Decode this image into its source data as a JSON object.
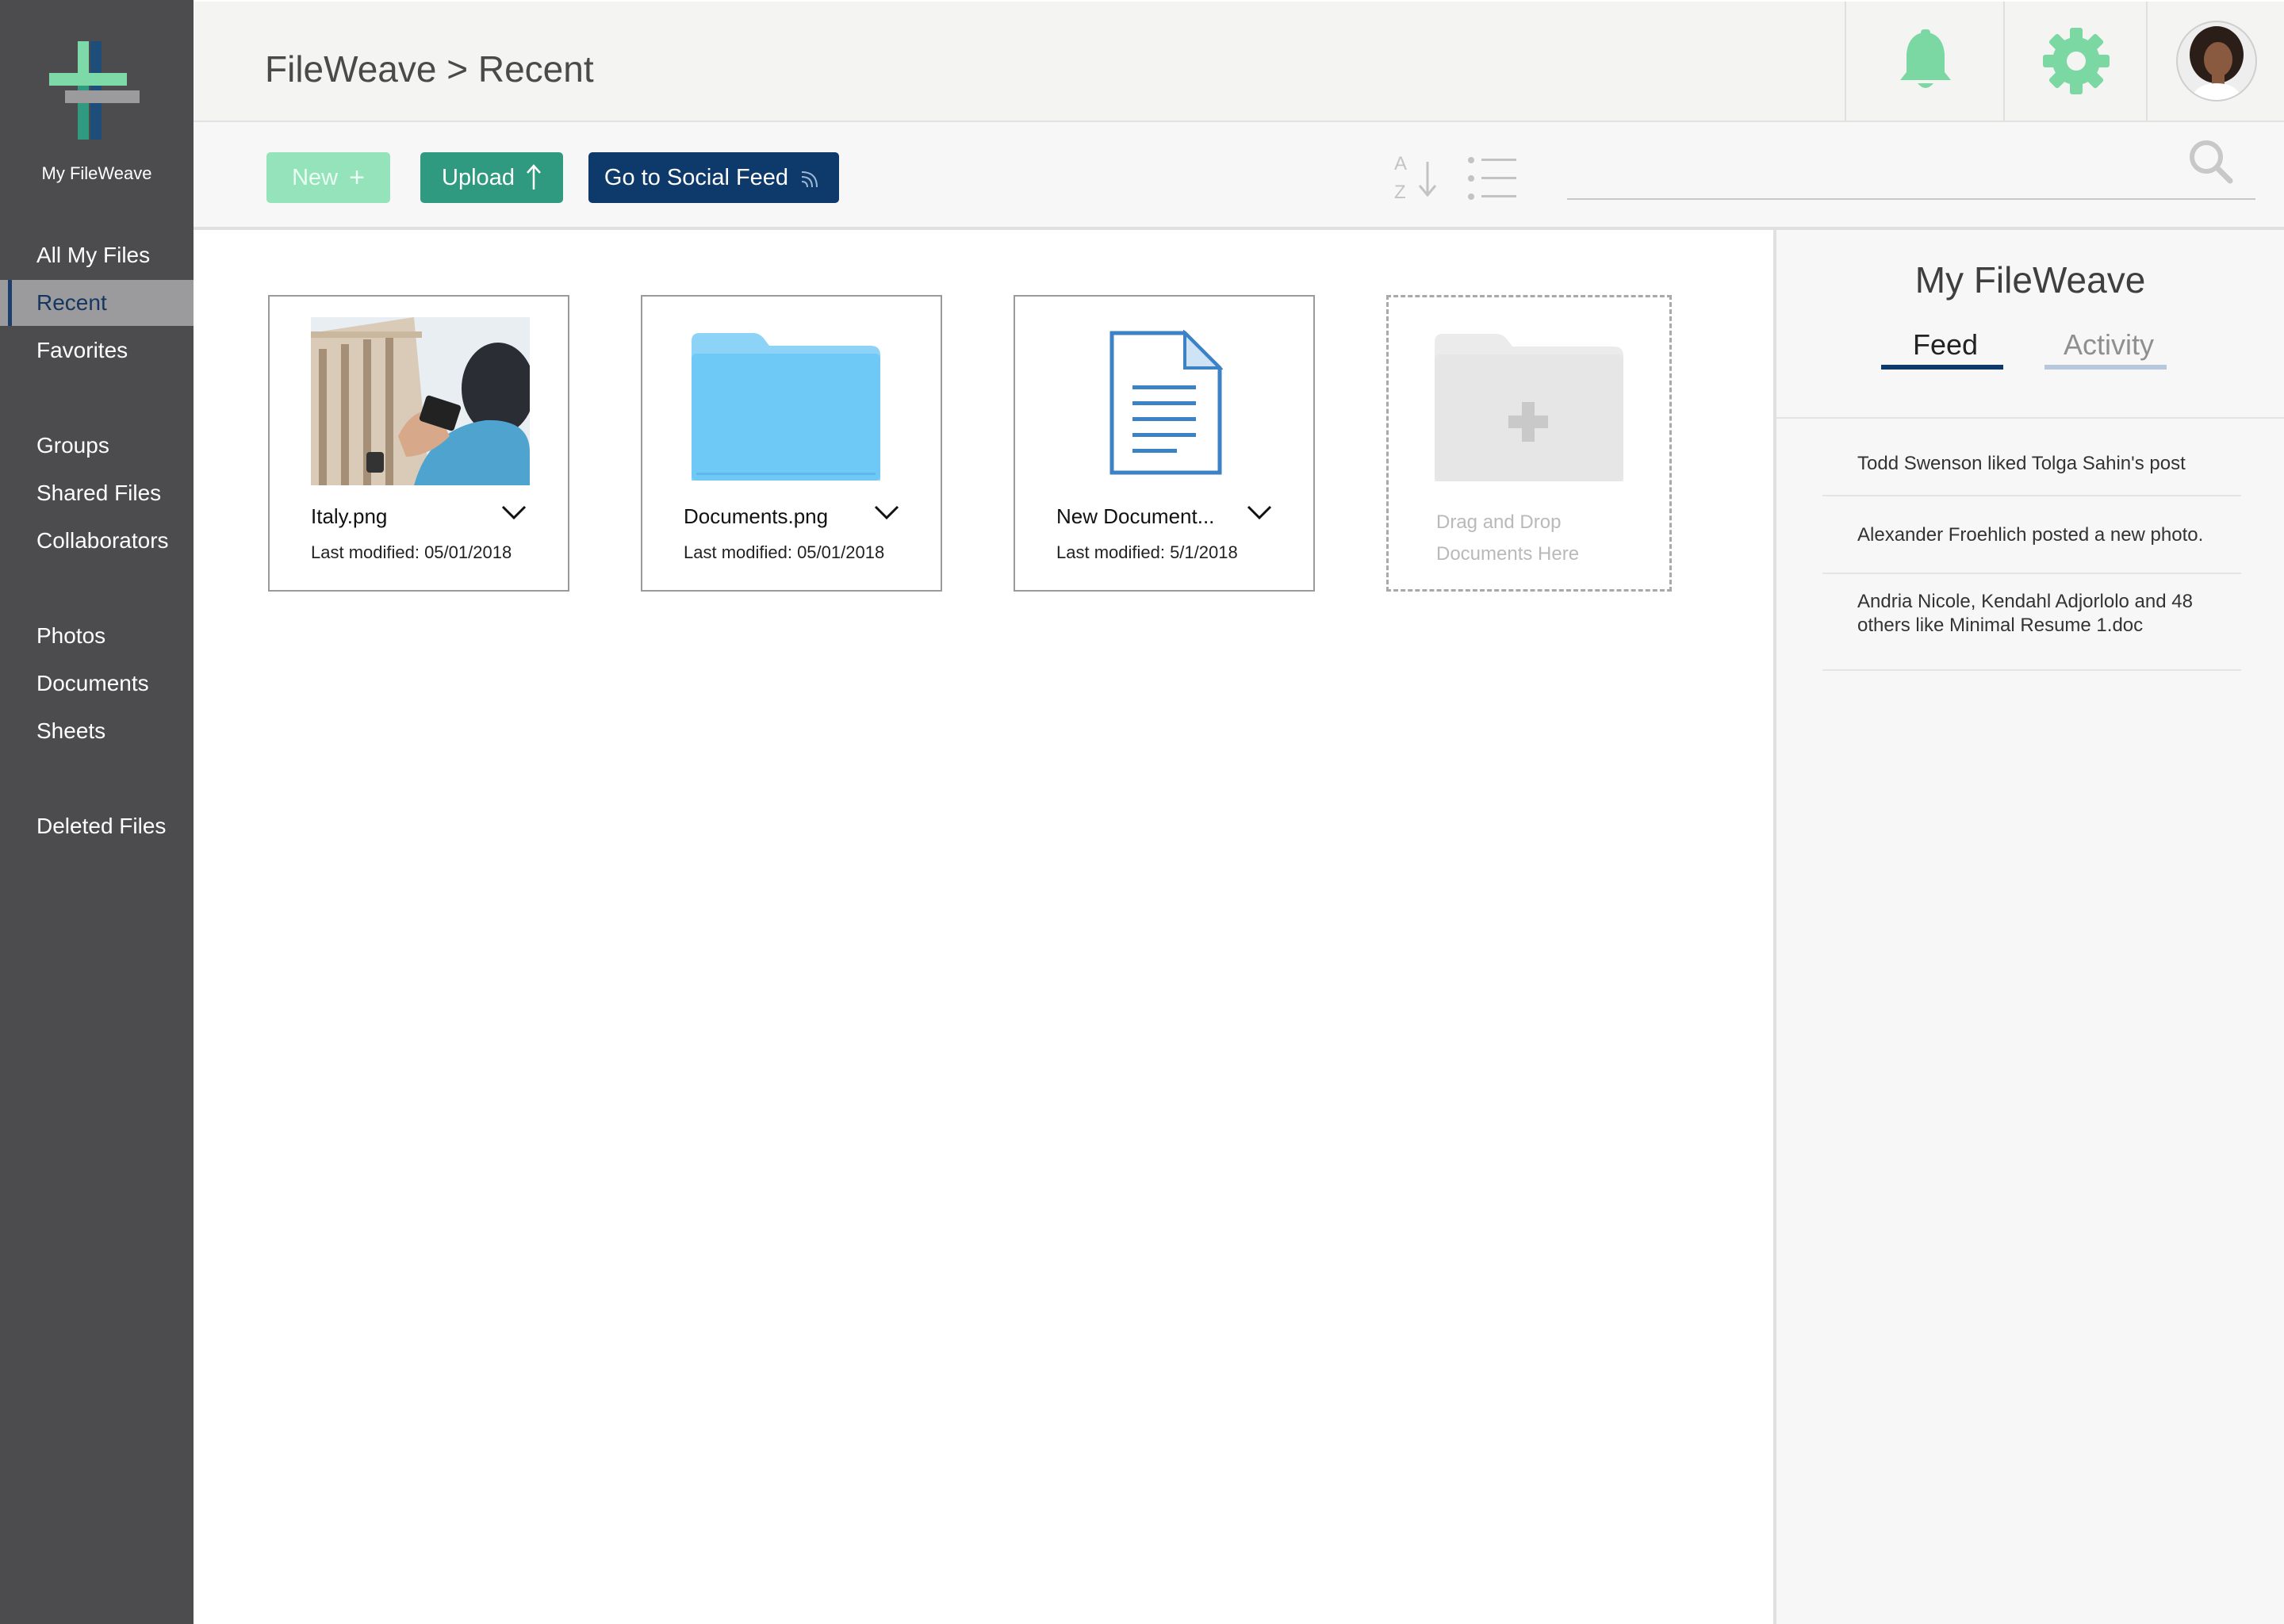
{
  "sidebar": {
    "logo_caption": "My FileWeave",
    "items": [
      {
        "label": "All My Files"
      },
      {
        "label": "Recent"
      },
      {
        "label": "Favorites"
      },
      {
        "label": "Groups"
      },
      {
        "label": "Shared Files"
      },
      {
        "label": "Collaborators"
      },
      {
        "label": "Photos"
      },
      {
        "label": "Documents"
      },
      {
        "label": "Sheets"
      },
      {
        "label": "Deleted Files"
      }
    ],
    "active_item": "Recent"
  },
  "header": {
    "breadcrumb": "FileWeave > Recent",
    "icons": [
      "bell-icon",
      "gear-icon",
      "user-avatar"
    ]
  },
  "toolbar": {
    "new_label": "New",
    "upload_label": "Upload",
    "feed_label": "Go to Social Feed",
    "search_placeholder": ""
  },
  "files": [
    {
      "name": "Italy.png",
      "modified": "Last modified: 05/01/2018",
      "kind": "photo"
    },
    {
      "name": "Documents.png",
      "modified": "Last modified: 05/01/2018",
      "kind": "folder"
    },
    {
      "name": "New Document...",
      "modified": "Last modified: 5/1/2018",
      "kind": "document"
    }
  ],
  "dropzone": {
    "line1": "Drag and Drop",
    "line2": "Documents Here"
  },
  "panel": {
    "title": "My FileWeave",
    "tabs": [
      {
        "label": "Feed",
        "active": true
      },
      {
        "label": "Activity",
        "active": false
      }
    ],
    "feed": [
      "Todd Swenson liked Tolga Sahin's post",
      "Alexander Froehlich posted a new photo.",
      "Andria Nicole, Kendahl Adjorlolo and 48 others like Minimal Resume 1.doc"
    ]
  },
  "colors": {
    "sidebar_bg": "#4c4b4e",
    "accent_green": "#7bd8a3",
    "upload_teal": "#2f9a80",
    "navy": "#0d3a6b",
    "folder_blue": "#6ec9f7",
    "doc_blue": "#3d82c4"
  }
}
